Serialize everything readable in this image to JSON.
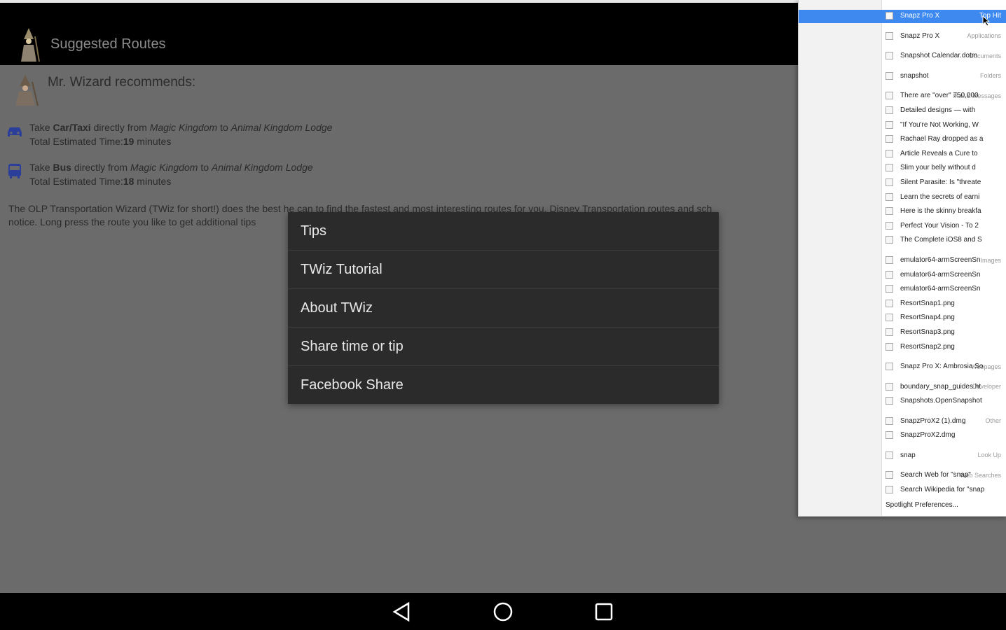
{
  "app_bar": {
    "title": "Suggested Routes"
  },
  "header": {
    "text": "Mr. Wizard recommends:"
  },
  "routes": [
    {
      "icon": "car-icon",
      "pre": "Take ",
      "mode": "Car/Taxi",
      "mid": " directly from ",
      "from": "Magic Kingdom",
      "to_word": " to ",
      "to": "Animal Kingdom Lodge",
      "time_label": "Total Estimated Time:",
      "time_value": "19",
      "time_unit": " minutes"
    },
    {
      "icon": "bus-icon",
      "pre": "Take ",
      "mode": "Bus",
      "mid": " directly from ",
      "from": "Magic Kingdom",
      "to_word": " to ",
      "to": "Animal Kingdom Lodge",
      "time_label": "Total Estimated Time:",
      "time_value": "18",
      "time_unit": " minutes"
    }
  ],
  "description": {
    "line1": "The OLP Transportation Wizard (TWiz for short!) does the best he can to find the fastest and most interesting routes for you. Disney Transportation routes and sch",
    "line2": "notice. Long press the route you like to get additional tips"
  },
  "menu": {
    "items": [
      "Tips",
      "TWiz Tutorial",
      "About TWiz",
      "Share time or tip",
      "Facebook Share"
    ]
  },
  "spotlight": {
    "categories": {
      "top_hit": "Top Hit",
      "applications": "Applications",
      "documents": "Documents",
      "folders": "Folders",
      "mail": "Mail & Messages",
      "images": "Images",
      "webpages": "Webpages",
      "developer": "Developer",
      "other": "Other",
      "lookup": "Look Up",
      "web_searches": "Web Searches"
    },
    "results": [
      {
        "text": "Snapz Pro X",
        "selected": true
      },
      {
        "text": "Snapz Pro X"
      },
      {
        "text": "Snapshot Calendar.dotm"
      },
      {
        "text": "snapshot"
      },
      {
        "text": "There are \"over\" 750,000"
      },
      {
        "text": "Detailed designs — with"
      },
      {
        "text": "\"If You're Not Working, W"
      },
      {
        "text": "Rachael Ray dropped as a"
      },
      {
        "text": "Article Reveals a Cure to"
      },
      {
        "text": "Slim your belly without d"
      },
      {
        "text": "Silent Parasite: Is \"threate"
      },
      {
        "text": "Learn the secrets of earni"
      },
      {
        "text": "Here is the skinny breakfa"
      },
      {
        "text": "Perfect Your Vision - To 2"
      },
      {
        "text": "The Complete iOS8 and S"
      },
      {
        "text": "emulator64-armScreenSn"
      },
      {
        "text": "emulator64-armScreenSn"
      },
      {
        "text": "emulator64-armScreenSn"
      },
      {
        "text": "ResortSnap1.png"
      },
      {
        "text": "ResortSnap4.png"
      },
      {
        "text": "ResortSnap3.png"
      },
      {
        "text": "ResortSnap2.png"
      },
      {
        "text": "Snapz Pro X: Ambrosia So"
      },
      {
        "text": "boundary_snap_guides.ht"
      },
      {
        "text": "Snapshots.OpenSnapshot"
      },
      {
        "text": "SnapzProX2 (1).dmg"
      },
      {
        "text": "SnapzProX2.dmg"
      },
      {
        "text": "snap"
      },
      {
        "text": "Search Web for \"snap\""
      },
      {
        "text": "Search Wikipedia for \"snap"
      }
    ],
    "preferences": "Spotlight Preferences..."
  },
  "colors": {
    "selection": "#3d89f0",
    "menu_bg": "#2b2b2b",
    "dim_bg": "#6b6b6b",
    "route_icon": "#2b3f9a"
  }
}
